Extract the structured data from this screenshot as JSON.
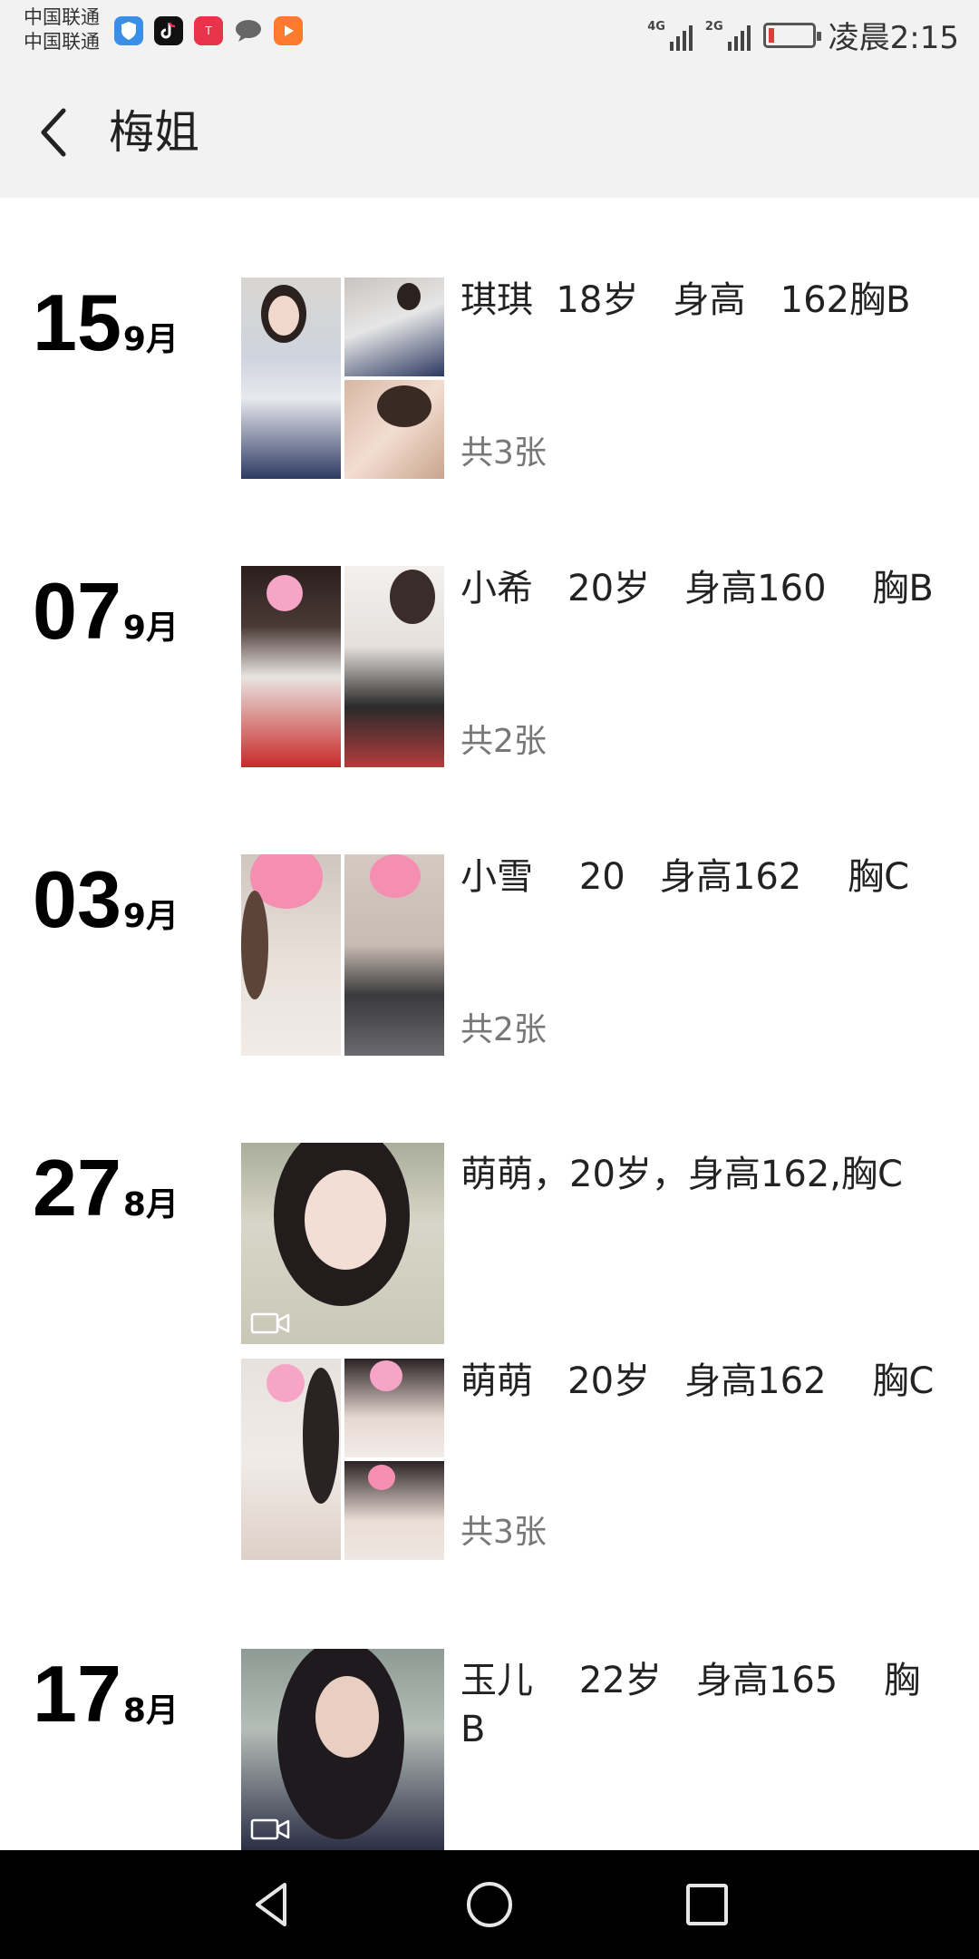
{
  "status_bar": {
    "carrier_1": "中国联通",
    "carrier_2": "中国联通",
    "network_1": "4G",
    "network_2": "2G",
    "time": "凌晨2:15",
    "battery_color": "#e23b3b"
  },
  "header": {
    "title": "梅姐",
    "back_icon": "chevron-left-icon"
  },
  "posts": [
    {
      "day": "15",
      "month": "9月",
      "items": [
        {
          "caption": "琪琪  18岁   身高   162胸B",
          "count": "共3张",
          "photos": 3
        }
      ]
    },
    {
      "day": "07",
      "month": "9月",
      "items": [
        {
          "caption": "小希   20岁   身高160    胸B",
          "count": "共2张",
          "photos": 2
        }
      ]
    },
    {
      "day": "03",
      "month": "9月",
      "items": [
        {
          "caption": "小雪    20   身高162    胸C",
          "count": "共2张",
          "photos": 2
        }
      ]
    },
    {
      "day": "27",
      "month": "8月",
      "items": [
        {
          "caption": "萌萌，20岁，身高162,胸C",
          "count": "",
          "photos": 1,
          "video": true
        },
        {
          "caption": "萌萌   20岁   身高162    胸C",
          "count": "共3张",
          "photos": 3
        }
      ]
    },
    {
      "day": "17",
      "month": "8月",
      "items": [
        {
          "caption": "玉儿    22岁   身高165    胸B",
          "count": "",
          "photos": 1,
          "video": true
        }
      ]
    }
  ],
  "nav": {
    "back": "triangle-back-icon",
    "home": "circle-home-icon",
    "recents": "square-recents-icon"
  }
}
